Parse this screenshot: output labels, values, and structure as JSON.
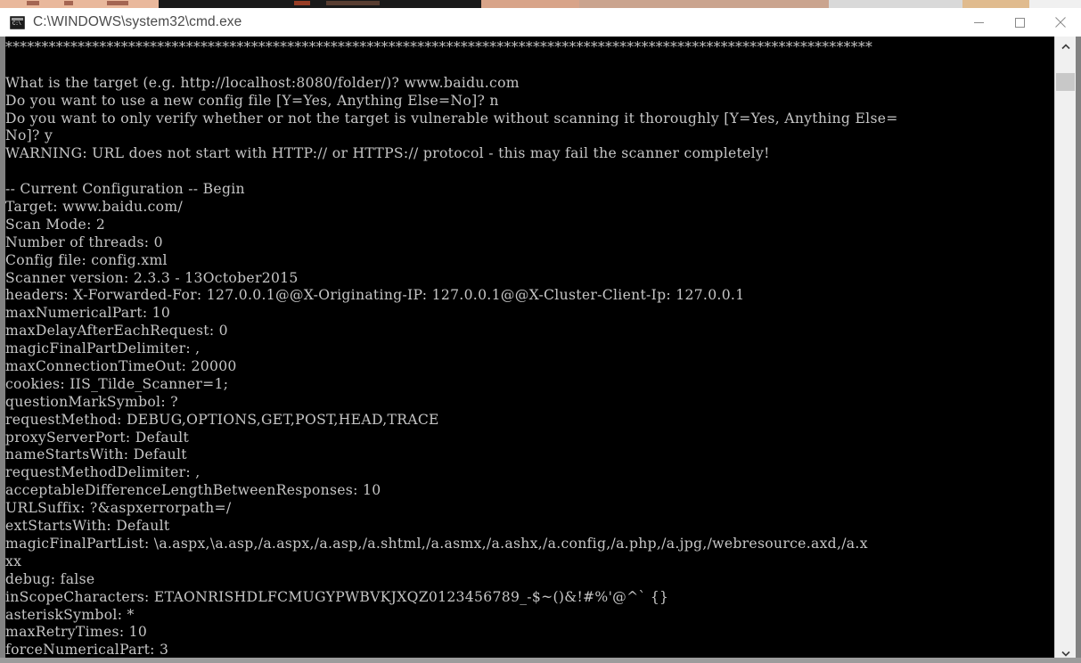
{
  "window": {
    "title": "C:\\WINDOWS\\system32\\cmd.exe",
    "icon": "cmd-console-icon",
    "controls": {
      "minimize": "minimize-icon",
      "maximize": "maximize-icon",
      "close": "close-icon"
    },
    "background_color": "#000000",
    "text_color": "#c6c6c6",
    "titlebar_color": "#ffffff",
    "titlebar_text_color": "#4a4a4a"
  },
  "scrollbar": {
    "up_arrow": "chevron-up-icon",
    "down_arrow": "chevron-down-icon",
    "thumb_position_percent": 3,
    "thumb_size_percent": 3
  },
  "terminal": {
    "lines": [
      "************************************************************************************************************************",
      "",
      "What is the target (e.g. http://localhost:8080/folder/)? www.baidu.com",
      "Do you want to use a new config file [Y=Yes, Anything Else=No]? n",
      "Do you want to only verify whether or not the target is vulnerable without scanning it thoroughly [Y=Yes, Anything Else=",
      "No]? y",
      "WARNING: URL does not start with HTTP:// or HTTPS:// protocol - this may fail the scanner completely!",
      "",
      "-- Current Configuration -- Begin",
      "Target: www.baidu.com/",
      "Scan Mode: 2",
      "Number of threads: 0",
      "Config file: config.xml",
      "Scanner version: 2.3.3 - 13October2015",
      "headers: X-Forwarded-For: 127.0.0.1@@X-Originating-IP: 127.0.0.1@@X-Cluster-Client-Ip: 127.0.0.1",
      "maxNumericalPart: 10",
      "maxDelayAfterEachRequest: 0",
      "magicFinalPartDelimiter: ,",
      "maxConnectionTimeOut: 20000",
      "cookies: IIS_Tilde_Scanner=1;",
      "questionMarkSymbol: ?",
      "requestMethod: DEBUG,OPTIONS,GET,POST,HEAD,TRACE",
      "proxyServerPort: Default",
      "nameStartsWith: Default",
      "requestMethodDelimiter: ,",
      "acceptableDifferenceLengthBetweenResponses: 10",
      "URLSuffix: ?&aspxerrorpath=/",
      "extStartsWith: Default",
      "magicFinalPartList: \\a.aspx,\\a.asp,/a.aspx,/a.asp,/a.shtml,/a.asmx,/a.ashx,/a.config,/a.php,/a.jpg,/webresource.axd,/a.x",
      "xx",
      "debug: false",
      "inScopeCharacters: ETAONRISHDLFCMUGYPWBVKJXQZ0123456789_-$~()&!#%'@^` {}",
      "asteriskSymbol: *",
      "maxRetryTimes: 10",
      "forceNumericalPart: 3"
    ]
  }
}
